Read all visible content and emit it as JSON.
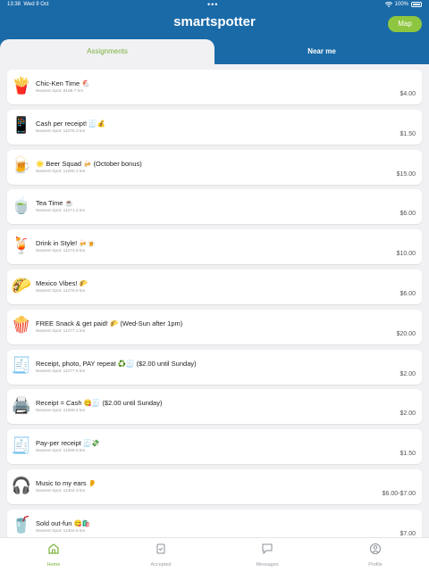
{
  "status": {
    "time": "13:38",
    "date": "Wed 9 Oct",
    "battery": "100%"
  },
  "header": {
    "brand": "smartspotter",
    "map_label": "Map",
    "accent": "#1a6aa8",
    "green": "#8ec63f"
  },
  "tabs": {
    "assignments": "Assignments",
    "near_me": "Near me"
  },
  "assignments": [
    {
      "icon": "🍟",
      "title": "Chic-Ken Time 🐔",
      "sub": "Nearest Spot: 8188.7 km",
      "price": "$4.00"
    },
    {
      "icon": "📱",
      "title": "Cash per receipt! 🧾💰",
      "sub": "Nearest Spot: 11076.3 km",
      "price": "$1.50"
    },
    {
      "icon": "🍺",
      "title": "🌟 Beer Squad 🍻 (October bonus)",
      "sub": "Nearest Spot: 11265.1 km",
      "price": "$15.00"
    },
    {
      "icon": "🍵",
      "title": "Tea Time ☕",
      "sub": "Nearest Spot: 11271.2 km",
      "price": "$6.00"
    },
    {
      "icon": "🍹",
      "title": "Drink in Style! 🍻🍺",
      "sub": "Nearest Spot: 11274.5 km",
      "price": "$10.00"
    },
    {
      "icon": "🌮",
      "title": "Mexico Vibes! 🌮",
      "sub": "Nearest Spot: 11276.9 km",
      "price": "$6.00"
    },
    {
      "icon": "🍿",
      "title": "FREE Snack & get paid! 🌮 (Wed-Sun after 1pm)",
      "sub": "Nearest Spot: 11277.1 km",
      "price": "$20.00"
    },
    {
      "icon": "🧾",
      "title": "Receipt, photo, PAY repeat ♻️🧾 ($2.00 until Sunday)",
      "sub": "Nearest Spot: 11277.5 km",
      "price": "$2.00"
    },
    {
      "icon": "🖨️",
      "title": "Receipt = Cash 😋🧾 ($2.00 until Sunday)",
      "sub": "Nearest Spot: 11288.4 km",
      "price": "$2.00"
    },
    {
      "icon": "🧾",
      "title": "Pay-per receipt 🧾💸",
      "sub": "Nearest Spot: 11289.5 km",
      "price": "$1.50"
    },
    {
      "icon": "🎧",
      "title": "Music to my ears 👂",
      "sub": "Nearest Spot: 11304.3 km",
      "price": "$6.00-$7.00"
    },
    {
      "icon": "🥤",
      "title": "Sold out-fun 😋🛍️",
      "sub": "Nearest Spot: 11304.6 km",
      "price": "$7.00"
    }
  ],
  "tabbar": {
    "home": "Home",
    "accepted": "Accepted",
    "messages": "Messages",
    "profile": "Profile"
  }
}
